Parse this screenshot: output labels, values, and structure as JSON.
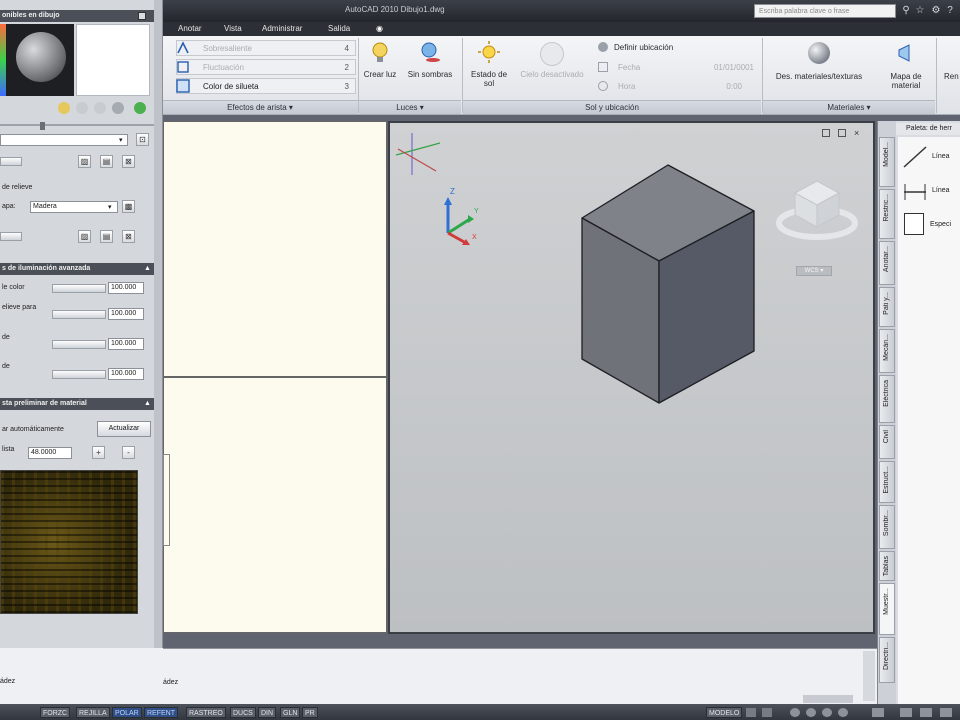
{
  "titlebar": {
    "title": "AutoCAD 2010    Dibujo1.dwg",
    "search_placeholder": "Escriba palabra clave o frase"
  },
  "menu_tabs": [
    "Anotar",
    "Vista",
    "Administrar",
    "Salida"
  ],
  "ribbon": {
    "edge_effects": {
      "rows": [
        {
          "label": "Sobresaliente",
          "value": "4"
        },
        {
          "label": "Fluctuación",
          "value": "2"
        },
        {
          "label": "Color de silueta",
          "value": "3"
        }
      ],
      "panel_label": "Efectos de arista ▾"
    },
    "lights": {
      "create_light": "Crear luz",
      "no_shadows": "Sin sombras",
      "panel_label": "Luces ▾"
    },
    "sun": {
      "sun_status": "Estado de sol",
      "sky_off": "Cielo desactivado",
      "set_location": "Definir ubicación",
      "date_label": "Fecha",
      "date_value": "01/01/0001",
      "time_label": "Hora",
      "time_value": "0:00",
      "panel_label": "Sol y ubicación"
    },
    "materials": {
      "des_materials": "Des. materiales/texturas",
      "material_map": "Mapa de material",
      "render": "Ren",
      "panel_label": "Materiales ▾"
    }
  },
  "left_palette": {
    "header1": "onibles en dibujo",
    "dropdown_value": "",
    "relief_label": "de relieve",
    "map_label": "apa:",
    "map_value": "Madera",
    "header2": "s de iluminación avanzada",
    "rows": [
      {
        "label": "le color",
        "value": "100.000"
      },
      {
        "label": "elieve para",
        "value": "100.000"
      },
      {
        "label": "de",
        "value": "100.000"
      },
      {
        "label": "de",
        "value": "100.000"
      }
    ],
    "header3": "sta preliminar de material",
    "auto_label": "ar automáticamente",
    "update_button": "Actualizar",
    "size_label": "lista",
    "size_value": "48.0000",
    "plus": "+",
    "minus": "-"
  },
  "viewcube": {
    "label": "WCS ▾"
  },
  "right_palette": {
    "title": "Paleta: de herr",
    "tabs": [
      "Model...",
      "Restric...",
      "Anotar...",
      "Pati y...",
      "Mecán...",
      "Eléctrica",
      "Civil",
      "Estruct...",
      "Sombr...",
      "Tablas",
      "Muestr...",
      "Directri..."
    ],
    "items": [
      "Línea",
      "Línea",
      "Especi"
    ]
  },
  "command": {
    "line1": "",
    "line2": "ádez"
  },
  "status": {
    "buttons": [
      "FORZC",
      "REJILLA",
      "POLAR",
      "REFENT",
      "RASTREO",
      "DUCS",
      "DIN",
      "GLN",
      "PR"
    ],
    "active": [
      "POLAR",
      "REFENT"
    ],
    "model": "MODELO"
  },
  "colors": {
    "accent": "#2f4f86",
    "viewport_bg": "#c6c8cb",
    "paper": "#fcfbee"
  }
}
